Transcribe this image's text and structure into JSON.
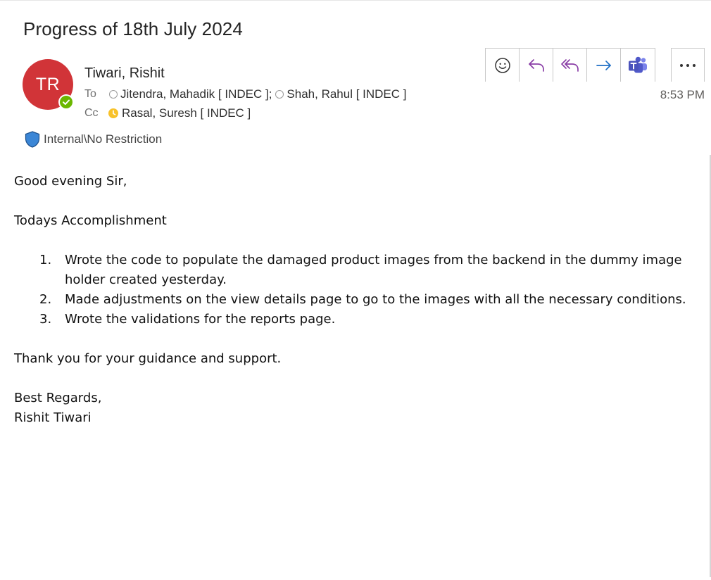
{
  "email": {
    "subject": "Progress of 18th July 2024",
    "sender": {
      "initials": "TR",
      "name": "Tiwari, Rishit",
      "avatar_color": "#d13438",
      "presence": "available"
    },
    "to_label": "To",
    "cc_label": "Cc",
    "to": [
      {
        "name": "Jitendra, Mahadik [ INDEC ];",
        "status": "offline"
      },
      {
        "name": "Shah, Rahul [ INDEC ]",
        "status": "offline"
      }
    ],
    "cc": [
      {
        "name": "Rasal, Suresh [ INDEC ]",
        "status": "away"
      }
    ],
    "classification": "Internal\\No Restriction",
    "time": "8:53 PM"
  },
  "toolbar": {
    "icons": [
      "emoji-icon",
      "reply-icon",
      "reply-all-icon",
      "forward-icon",
      "teams-icon",
      "more-icon"
    ]
  },
  "body": {
    "greeting": "Good evening Sir,",
    "heading": "Todays Accomplishment",
    "items": [
      {
        "num": "1.",
        "text": "Wrote the code to populate the damaged product images from the backend in the dummy image holder created yesterday."
      },
      {
        "num": "2.",
        "text": "Made adjustments on the view details page to go to the images with all the necessary conditions."
      },
      {
        "num": "3.",
        "text": "Wrote the validations for the reports page."
      }
    ],
    "thanks": "Thank you for your guidance and support.",
    "closing": "Best Regards,",
    "signature": "Rishit Tiwari"
  }
}
